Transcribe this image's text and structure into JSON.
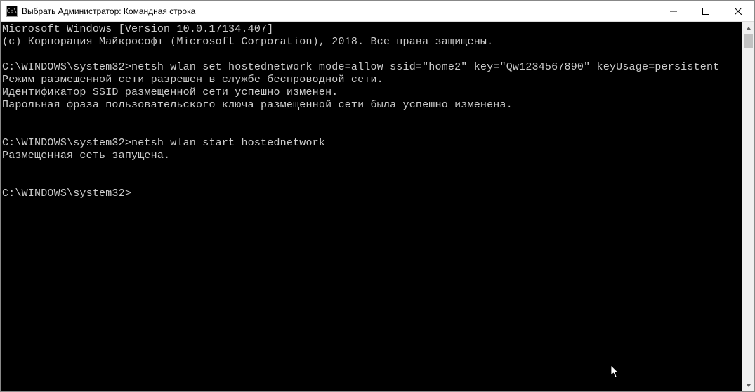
{
  "window": {
    "title": "Выбрать Администратор: Командная строка",
    "icon_label": "C:\\"
  },
  "console": {
    "lines": [
      "Microsoft Windows [Version 10.0.17134.407]",
      "(c) Корпорация Майкрософт (Microsoft Corporation), 2018. Все права защищены.",
      "",
      "C:\\WINDOWS\\system32>netsh wlan set hostednetwork mode=allow ssid=\"home2\" key=\"Qw1234567890\" keyUsage=persistent",
      "Режим размещенной сети разрешен в службе беспроводной сети.",
      "Идентификатор SSID размещенной сети успешно изменен.",
      "Парольная фраза пользовательского ключа размещенной сети была успешно изменена.",
      "",
      "",
      "C:\\WINDOWS\\system32>netsh wlan start hostednetwork",
      "Размещенная сеть запущена.",
      "",
      "",
      "C:\\WINDOWS\\system32>"
    ]
  }
}
